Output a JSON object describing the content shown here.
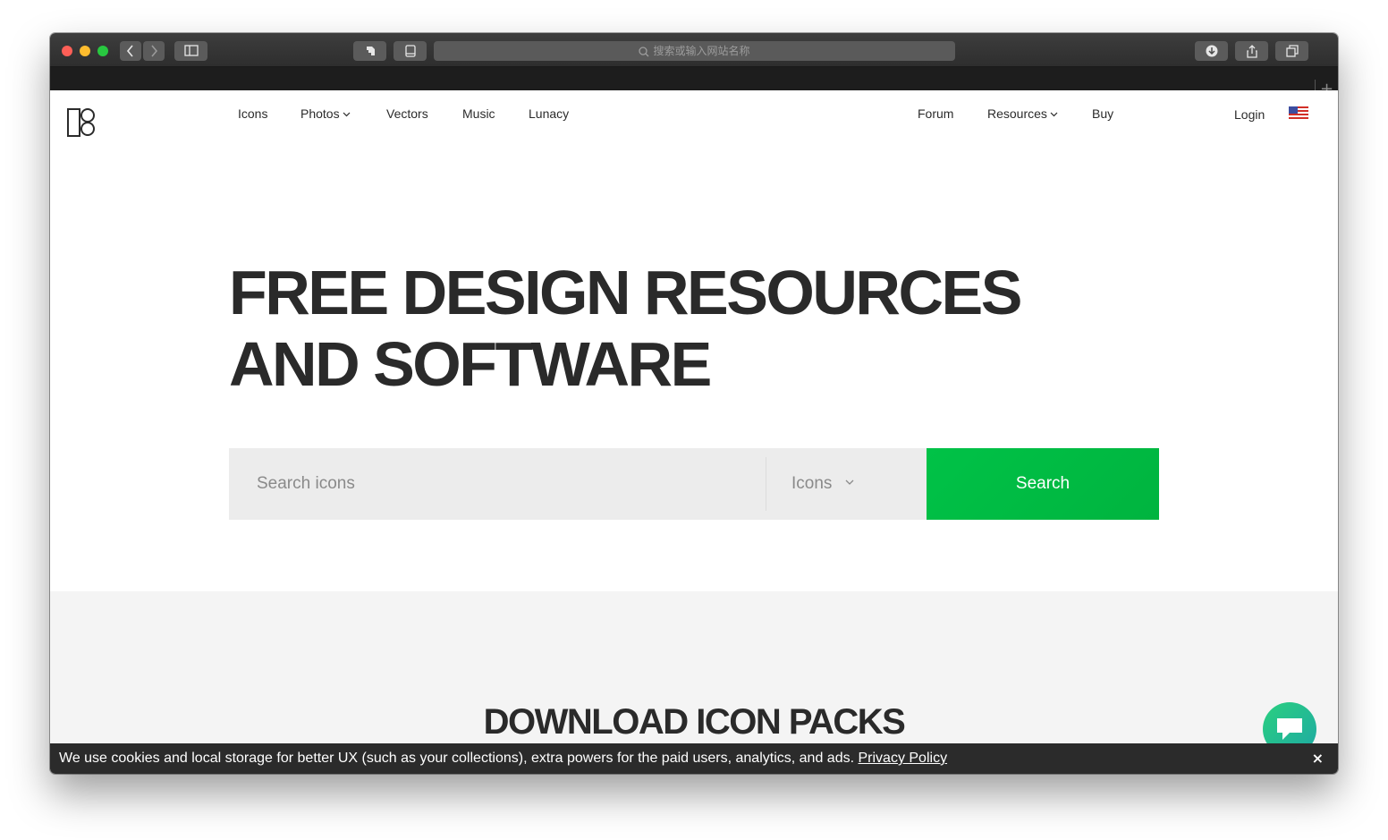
{
  "browser": {
    "address_placeholder": "搜索或输入网站名称",
    "new_tab_label": "+"
  },
  "nav": {
    "left_items": [
      {
        "label": "Icons"
      },
      {
        "label": "Photos"
      },
      {
        "label": "Vectors"
      },
      {
        "label": "Music"
      },
      {
        "label": "Lunacy"
      }
    ],
    "right_items": [
      {
        "label": "Forum"
      },
      {
        "label": "Resources"
      },
      {
        "label": "Buy"
      }
    ],
    "login_label": "Login",
    "flag_icon": "us-flag-icon"
  },
  "hero": {
    "title_line1": "FREE DESIGN RESOURCES",
    "title_line2": "AND SOFTWARE"
  },
  "search": {
    "placeholder": "Search icons",
    "type_value": "Icons",
    "button_label": "Search"
  },
  "section": {
    "title": "DOWNLOAD ICON PACKS"
  },
  "cookie_banner": {
    "text": "We use cookies and local storage for better UX (such as your collections), extra powers for the paid users, analytics, and ads.",
    "link_label": "Privacy Policy",
    "close_label": "×"
  },
  "colors": {
    "accent_green": "#00c247",
    "text_dark": "#2a2a2a",
    "search_bg": "#ececec",
    "section_bg": "#f4f4f4",
    "cookie_bg": "#2b2b2b"
  }
}
